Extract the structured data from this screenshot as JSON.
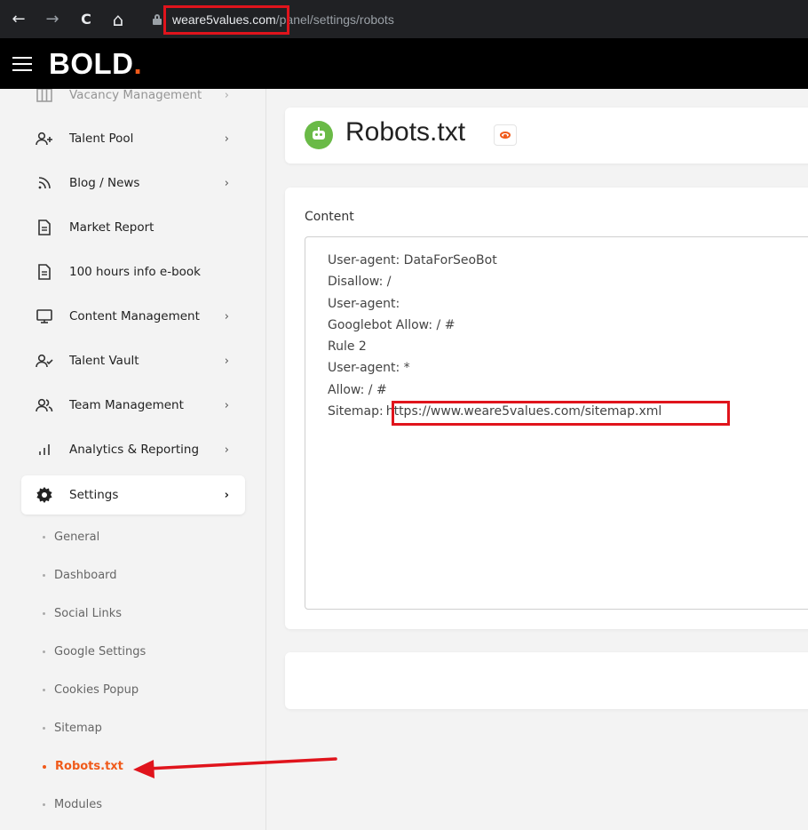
{
  "browser": {
    "back_icon": "←",
    "forward_icon": "→",
    "reload_icon": "C",
    "home_icon": "⌂",
    "url_host": "weare5values.com",
    "url_path": "/panel/settings/robots"
  },
  "header": {
    "logo_text": "BOLD",
    "logo_dot": ".",
    "accent_color": "#f05a1a"
  },
  "sidebar": {
    "items": [
      {
        "label": "Vacancy Management",
        "icon": "columns-icon",
        "chevron": "›"
      },
      {
        "label": "Talent Pool",
        "icon": "user-plus-icon",
        "chevron": "›"
      },
      {
        "label": "Blog / News",
        "icon": "rss-icon",
        "chevron": "›"
      },
      {
        "label": "Market Report",
        "icon": "document-icon",
        "chevron": ""
      },
      {
        "label": "100 hours info e-book",
        "icon": "document-icon",
        "chevron": ""
      },
      {
        "label": "Content Management",
        "icon": "monitor-icon",
        "chevron": "›"
      },
      {
        "label": "Talent Vault",
        "icon": "user-check-icon",
        "chevron": "›"
      },
      {
        "label": "Team Management",
        "icon": "users-icon",
        "chevron": "›"
      },
      {
        "label": "Analytics & Reporting",
        "icon": "bar-chart-icon",
        "chevron": "›"
      },
      {
        "label": "Settings",
        "icon": "gear-icon",
        "chevron": "›"
      }
    ],
    "subitems": [
      "General",
      "Dashboard",
      "Social Links",
      "Google Settings",
      "Cookies Popup",
      "Sitemap",
      "Robots.txt",
      "Modules"
    ]
  },
  "main": {
    "page_title": "Robots.txt",
    "content_label": "Content",
    "content_lines": [
      "User-agent: DataForSeoBot",
      "Disallow: /",
      "User-agent:",
      "Googlebot Allow: / #",
      "Rule 2",
      "User-agent: *",
      "Allow: / #"
    ],
    "sitemap_prefix": "Sitemap:",
    "sitemap_url": "https://www.weare5values.com/sitemap.xml"
  }
}
